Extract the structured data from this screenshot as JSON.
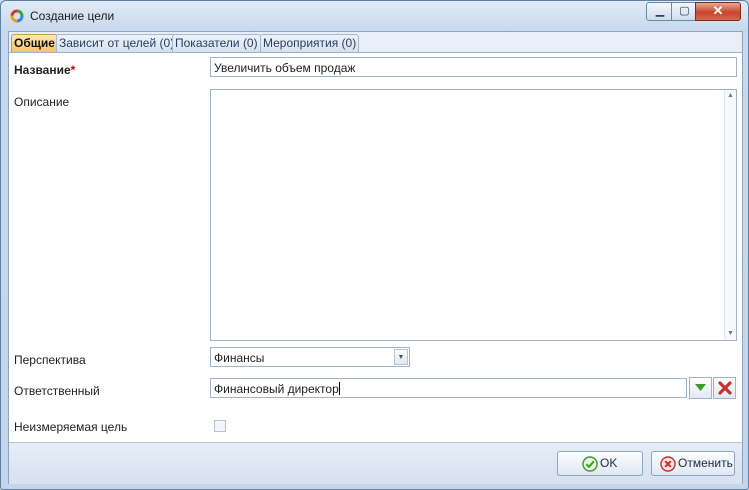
{
  "window": {
    "title": "Создание цели"
  },
  "tabs": [
    {
      "label": "Общие"
    },
    {
      "label": "Зависит от целей (0)"
    },
    {
      "label": "Показатели (0)"
    },
    {
      "label": "Мероприятия (0)"
    }
  ],
  "form": {
    "name_label": "Название",
    "required_mark": "*",
    "name_value": "Увеличить объем продаж",
    "description_label": "Описание",
    "description_value": "",
    "perspective_label": "Перспектива",
    "perspective_value": "Финансы",
    "responsible_label": "Ответственный",
    "responsible_value": "Финансовый директор",
    "unmeasurable_label": "Неизмеряемая цель",
    "unmeasurable_checked": false
  },
  "buttons": {
    "ok_label": "OK",
    "cancel_label": "Отменить"
  },
  "icons": {
    "app": "ring-logo-icon",
    "minimize": "minimize-icon",
    "maximize": "maximize-icon",
    "close": "close-icon",
    "dropdown": "triangle-down-icon",
    "select": "green-triangle-down-icon",
    "clear": "red-x-icon",
    "ok": "green-check-icon",
    "cancel": "red-circle-x-icon"
  },
  "colors": {
    "title_close": "#c8462e",
    "active_tab": "#f6c468",
    "required": "#dd0000",
    "ok_icon": "#3f9a2c",
    "cancel_icon": "#c9302c"
  }
}
